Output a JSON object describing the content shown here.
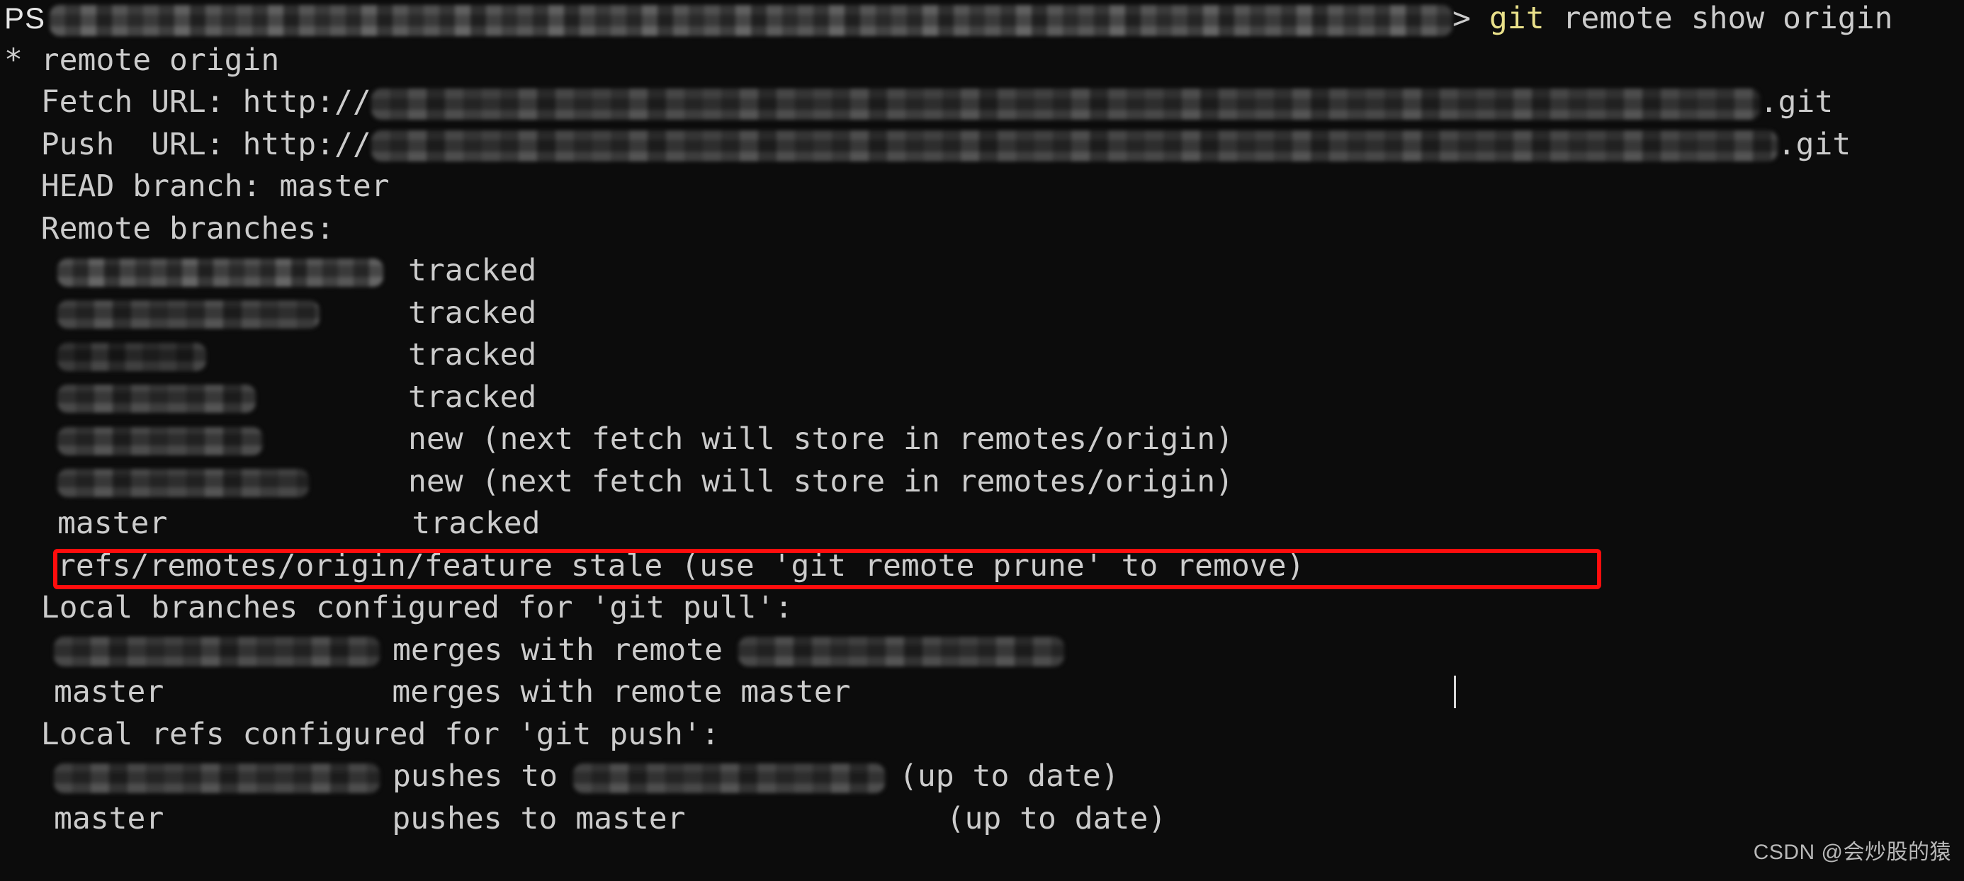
{
  "terminal": {
    "shell": "powershell",
    "background_color": "#0c0c0c",
    "foreground_color": "#cccccc",
    "accent_color": "#e9e08a",
    "highlight_color": "#ff0d0d",
    "prompt_label": "PS",
    "prompt_symbol": ">",
    "command_accent": "git",
    "command_rest": " remote show origin",
    "full_command": "git remote show origin"
  },
  "output": {
    "remote_header": "* remote origin",
    "fetch_url_label": "  Fetch URL: http://",
    "push_url_label": "  Push  URL: http://",
    "url_suffix": ".git",
    "head_branch": "  HEAD branch: master",
    "remote_branches_header": "  Remote branches:",
    "local_pull_header": "  Local branches configured for 'git pull':",
    "local_push_header": "  Local refs configured for 'git push':",
    "status_tracked": "tracked",
    "status_new": "new (next fetch will store in remotes/origin)",
    "stale_line": "refs/remotes/origin/feature stale (use 'git remote prune' to remove)",
    "master_branch": "master",
    "merges_with_remote": "merges with remote",
    "merges_with_remote_master": "merges with remote master",
    "pushes_to": "pushes to",
    "pushes_to_master": "pushes to master",
    "up_to_date": "(up to date)"
  },
  "remote_branches": [
    {
      "name_redacted": true,
      "redact_width": 460,
      "status": "tracked"
    },
    {
      "name_redacted": true,
      "redact_width": 370,
      "status": "tracked"
    },
    {
      "name_redacted": true,
      "redact_width": 210,
      "status": "tracked"
    },
    {
      "name_redacted": true,
      "redact_width": 280,
      "status": "tracked"
    },
    {
      "name_redacted": true,
      "redact_width": 290,
      "status": "new (next fetch will store in remotes/origin)"
    },
    {
      "name_redacted": true,
      "redact_width": 355,
      "status": "new (next fetch will store in remotes/origin)"
    },
    {
      "name_redacted": false,
      "name": "master",
      "status": "tracked"
    }
  ],
  "stale_ref": {
    "ref": "refs/remotes/origin/feature",
    "state": "stale",
    "hint": "(use 'git remote prune' to remove)",
    "highlighted": true
  },
  "pull_config": [
    {
      "branch_redacted": true,
      "redact_width": 460,
      "merges": "merges with remote",
      "remote_redacted": true,
      "remote_redact_width": 460
    },
    {
      "branch_redacted": false,
      "branch": "master",
      "merges": "merges with remote master",
      "remote_redacted": false
    }
  ],
  "push_config": [
    {
      "branch_redacted": true,
      "redact_width": 460,
      "pushes": "pushes to",
      "target_redacted": true,
      "target_redact_width": 440,
      "state": "(up to date)"
    },
    {
      "branch_redacted": false,
      "branch": "master",
      "pushes": "pushes to master",
      "target_redacted": false,
      "state": "(up to date)"
    }
  ],
  "watermark": {
    "text": "CSDN @会炒股的猿"
  }
}
